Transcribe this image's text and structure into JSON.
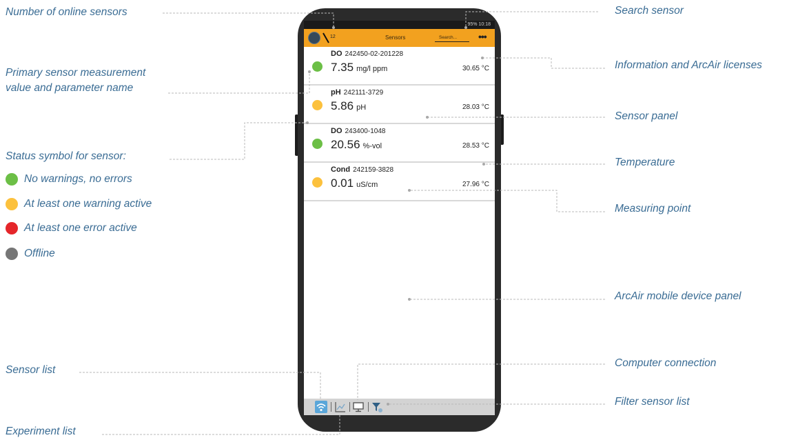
{
  "callouts": {
    "online_sensors": "Number of online sensors",
    "search_sensor": "Search sensor",
    "primary_measurement_line1": "Primary sensor measurement",
    "primary_measurement_line2": "value and parameter name",
    "info_licenses": "Information and ArcAir licenses",
    "sensor_panel": "Sensor panel",
    "status_symbol": "Status symbol for sensor:",
    "temperature": "Temperature",
    "measuring_point": "Measuring point",
    "mobile_device_panel": "ArcAir mobile device panel",
    "sensor_list": "Sensor list",
    "computer_connection": "Computer connection",
    "filter_sensor_list": "Filter sensor list",
    "experiment_list": "Experiment list"
  },
  "status_legend": [
    {
      "label": "No warnings, no errors",
      "color": "#6cbf46"
    },
    {
      "label": "At least one warning active",
      "color": "#fcc13d"
    },
    {
      "label": "At least one error active",
      "color": "#e5262a"
    },
    {
      "label": "Offline",
      "color": "#767676"
    }
  ],
  "app": {
    "status_bar": "95% 10:18",
    "online_count": "12",
    "title": "Sensors",
    "search_placeholder": "Search...",
    "menu": "•••",
    "accent": "#f2a11f"
  },
  "sensors": [
    {
      "param": "DO",
      "id": "242450-02-201228",
      "value": "7.35",
      "unit": "mg/l ppm",
      "temp": "30.65 °C",
      "status_color": "#6cbf46"
    },
    {
      "param": "pH",
      "id": "242111-3729",
      "value": "5.86",
      "unit": "pH",
      "temp": "28.03 °C",
      "status_color": "#fcc13d"
    },
    {
      "param": "DO",
      "id": "243400-1048",
      "value": "20.56",
      "unit": "%-vol",
      "temp": "28.53 °C",
      "status_color": "#6cbf46"
    },
    {
      "param": "Cond",
      "id": "242159-3828",
      "value": "0.01",
      "unit": "uS/cm",
      "temp": "27.96 °C",
      "status_color": "#fcc13d"
    }
  ],
  "bottom_icons": [
    "wifi-icon",
    "chart-icon",
    "monitor-icon",
    "filter-icon"
  ]
}
